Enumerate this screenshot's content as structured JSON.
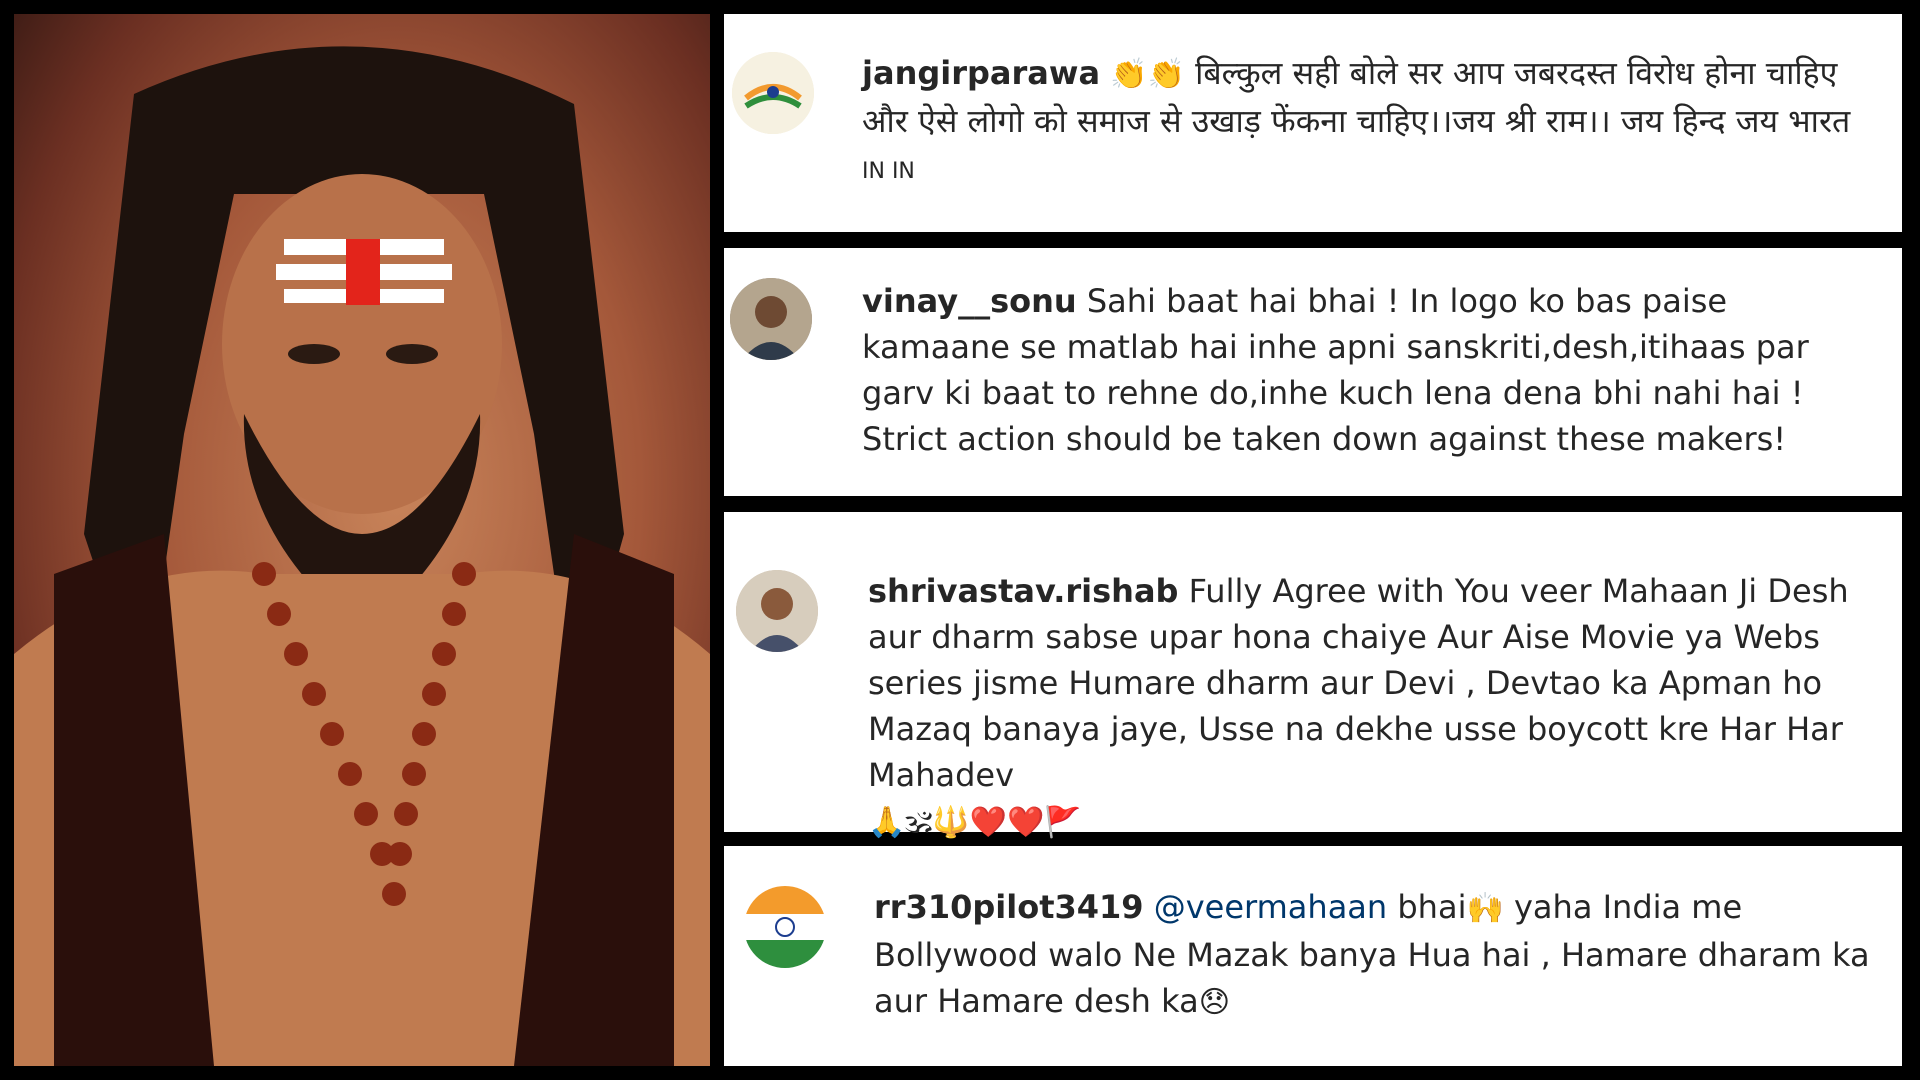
{
  "comments": [
    {
      "username": "jangirparawa",
      "emoji_lead": "👏👏",
      "text": " बिल्कुल सही बोले सर आप जबरदस्त विरोध होना चाहिए और ऐसे लोगो को समाज से उखाड़ फेंकना चाहिए।।जय श्री राम।। जय हिन्द जय भारत ",
      "tail": "IN IN",
      "avatar": "tricolor-logo"
    },
    {
      "username": "vinay__sonu",
      "text": " Sahi baat hai bhai ! In logo ko bas paise kamaane se matlab hai inhe apni sanskriti,desh,itihaas par garv ki baat to rehne do,inhe kuch lena dena bhi nahi hai ! Strict action should be taken down against these makers!",
      "avatar": "man-photo"
    },
    {
      "username": "shrivastav.rishab",
      "text": " Fully Agree with You veer Mahaan Ji Desh aur dharm sabse upar hona chaiye Aur Aise Movie ya Webs series jisme Humare dharm aur Devi , Devtao ka Apman ho Mazaq banaya jaye, Usse na dekhe usse boycott kre Har Har Mahadev",
      "emoji_tail": "🙏🕉🔱❤️❤️🚩",
      "avatar": "man-photo-2"
    },
    {
      "username": "rr310pilot3419",
      "mention": " @veermahaan",
      "text_pre": " bhai",
      "emoji_mid": "🙌",
      "text": " yaha India me Bollywood walo Ne Mazak banya Hua hai , Hamare dharam ka aur Hamare desh ka",
      "emoji_tail": "😞",
      "avatar": "india-flag"
    }
  ]
}
